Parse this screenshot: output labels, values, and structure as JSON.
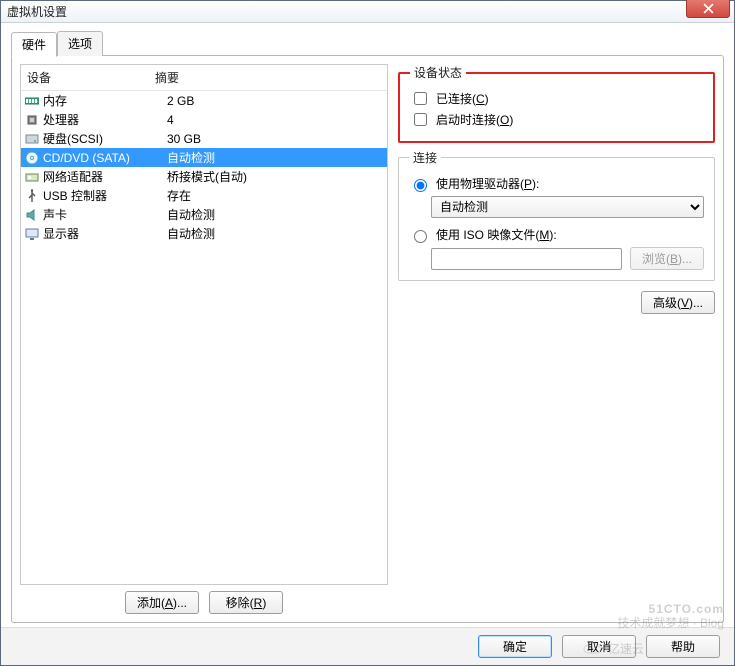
{
  "window": {
    "title": "虚拟机设置"
  },
  "tabs": {
    "hardware": "硬件",
    "options": "选项",
    "active": "hardware"
  },
  "list": {
    "header_device": "设备",
    "header_summary": "摘要",
    "rows": [
      {
        "icon": "memory-icon",
        "name": "内存",
        "summary": "2 GB"
      },
      {
        "icon": "cpu-icon",
        "name": "处理器",
        "summary": "4"
      },
      {
        "icon": "hdd-icon",
        "name": "硬盘(SCSI)",
        "summary": "30 GB"
      },
      {
        "icon": "cd-icon",
        "name": "CD/DVD (SATA)",
        "summary": "自动检测",
        "selected": true
      },
      {
        "icon": "nic-icon",
        "name": "网络适配器",
        "summary": "桥接模式(自动)"
      },
      {
        "icon": "usb-icon",
        "name": "USB 控制器",
        "summary": "存在"
      },
      {
        "icon": "sound-icon",
        "name": "声卡",
        "summary": "自动检测"
      },
      {
        "icon": "display-icon",
        "name": "显示器",
        "summary": "自动检测"
      }
    ]
  },
  "left_buttons": {
    "add": "添加(A)...",
    "remove": "移除(R)"
  },
  "status_group": {
    "legend": "设备状态",
    "connected_label": "已连接(C)",
    "connected_checked": false,
    "connect_power_label": "启动时连接(O)",
    "connect_power_checked": false
  },
  "conn_group": {
    "legend": "连接",
    "physical_label": "使用物理驱动器(P):",
    "physical_selected": true,
    "physical_drop_value": "自动检测",
    "iso_label": "使用 ISO 映像文件(M):",
    "iso_selected": false,
    "iso_value": "",
    "browse_label": "浏览(B)...",
    "advanced_label": "高级(V)..."
  },
  "footer": {
    "ok": "确定",
    "cancel": "取消",
    "help": "帮助"
  },
  "watermark": {
    "line1": "51CTO.com",
    "line2": "技术成就梦想 · Blog",
    "logo_text": "亿速云"
  }
}
